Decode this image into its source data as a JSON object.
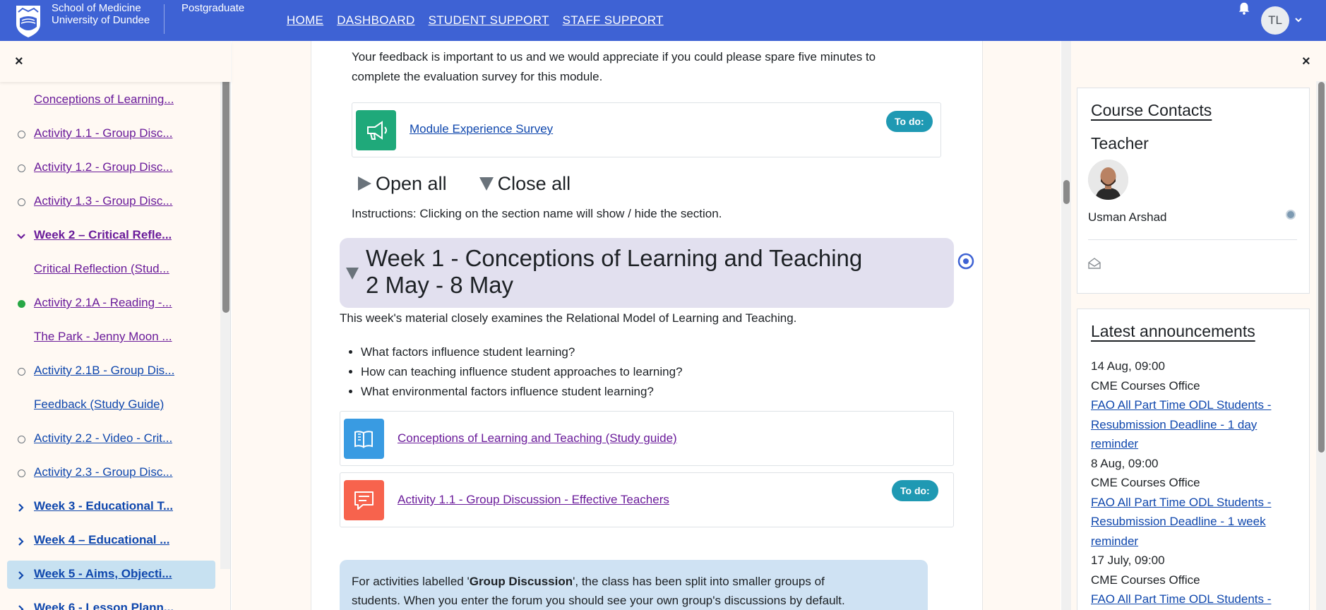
{
  "header": {
    "school_line1": "School of Medicine",
    "school_line2": "University of Dundee",
    "site_sub": "Postgraduate",
    "nav": [
      "HOME",
      "DASHBOARD",
      "STUDENT SUPPORT",
      "STAFF SUPPORT"
    ],
    "user_initials": "TL"
  },
  "course_index": {
    "close_label": "×",
    "items": [
      {
        "label": "Conceptions of Learning...",
        "mark": "none",
        "type": "activity",
        "visited": true
      },
      {
        "label": "Activity 1.1 - Group Disc...",
        "mark": "circle",
        "type": "activity",
        "visited": true
      },
      {
        "label": "Activity 1.2 - Group Disc...",
        "mark": "circle",
        "type": "activity",
        "visited": true
      },
      {
        "label": "Activity 1.3 - Group Disc...",
        "mark": "circle",
        "type": "activity",
        "visited": true
      },
      {
        "label": "Week 2 – Critical Refle...",
        "mark": "chevron-down",
        "type": "section",
        "visited": true
      },
      {
        "label": "Critical Reflection (Stud...",
        "mark": "none",
        "type": "activity",
        "visited": true
      },
      {
        "label": "Activity 2.1A - Reading -...",
        "mark": "done",
        "type": "activity",
        "visited": true
      },
      {
        "label": "The Park - Jenny Moon ...",
        "mark": "none",
        "type": "activity",
        "visited": true
      },
      {
        "label": "Activity 2.1B - Group Dis...",
        "mark": "circle",
        "type": "activity",
        "visited": false
      },
      {
        "label": "Feedback (Study Guide)",
        "mark": "none",
        "type": "activity",
        "visited": false
      },
      {
        "label": "Activity 2.2 - Video - Crit...",
        "mark": "circle",
        "type": "activity",
        "visited": false
      },
      {
        "label": "Activity 2.3 - Group Disc...",
        "mark": "circle",
        "type": "activity",
        "visited": false
      },
      {
        "label": "Week 3 - Educational T...",
        "mark": "chevron-right",
        "type": "section",
        "visited": false
      },
      {
        "label": "Week 4 – Educational ...",
        "mark": "chevron-right",
        "type": "section",
        "visited": false
      },
      {
        "label": "Week 5 - Aims, Objecti...",
        "mark": "chevron-right",
        "type": "section",
        "visited": false,
        "current": true
      },
      {
        "label": "Week 6 - Lesson Plann...",
        "mark": "chevron-right",
        "type": "section",
        "visited": false
      }
    ]
  },
  "main": {
    "feedback_text": "Your feedback is important to us and we would appreciate if you could please spare five minutes to complete the evaluation survey for this module.",
    "survey": {
      "label": "Module Experience Survey",
      "todo": "To do:",
      "icon": "megaphone-icon",
      "color": "#1fa97a"
    },
    "open_all": "Open all",
    "close_all": "Close all",
    "instructions": "Instructions: Clicking on the section name will show / hide the section.",
    "week": {
      "title_line1": "Week 1 - Conceptions of Learning and Teaching",
      "title_line2": "2 May - 8 May",
      "summary": "This week's material closely examines the Relational Model of Learning and Teaching.",
      "bullets": [
        "What factors influence student learning?",
        "How can teaching influence student approaches to learning?",
        "What environmental factors influence student learning?"
      ],
      "activities": [
        {
          "label": "Conceptions of Learning and Teaching (Study guide)",
          "icon": "book-icon",
          "color": "#399be2",
          "todo": ""
        },
        {
          "label": "Activity 1.1 - Group Discussion - Effective Teachers",
          "icon": "forum-icon",
          "color": "#f7634d",
          "todo": "To do:"
        }
      ]
    },
    "info": {
      "pre": "For activities labelled '",
      "bold": "Group Discussion",
      "post": "', the class has been split into smaller groups of",
      "line2": "students. When you enter the forum you should see your own group's discussions by default."
    }
  },
  "right_drawer": {
    "close_label": "×",
    "contacts": {
      "title": "Course Contacts",
      "role": "Teacher",
      "name": "Usman Arshad"
    },
    "announcements": {
      "title": "Latest announcements",
      "items": [
        {
          "date": "14 Aug, 09:00",
          "author": "CME Courses Office",
          "link": "FAO All Part Time ODL Students - Resubmission Deadline - 1 day reminder"
        },
        {
          "date": "8 Aug, 09:00",
          "author": "CME Courses Office",
          "link": "FAO All Part Time ODL Students - Resubmission Deadline - 1 week reminder"
        },
        {
          "date": "17 July, 09:00",
          "author": "CME Courses Office",
          "link": "FAO All Part Time ODL Students -"
        }
      ]
    }
  },
  "colors": {
    "navbar": "#3e62d4",
    "drawer_bg": "#fff9f3",
    "week_box": "#e2e0ef",
    "todo_badge": "#1f99b3",
    "info_box": "#cfe2f3"
  }
}
